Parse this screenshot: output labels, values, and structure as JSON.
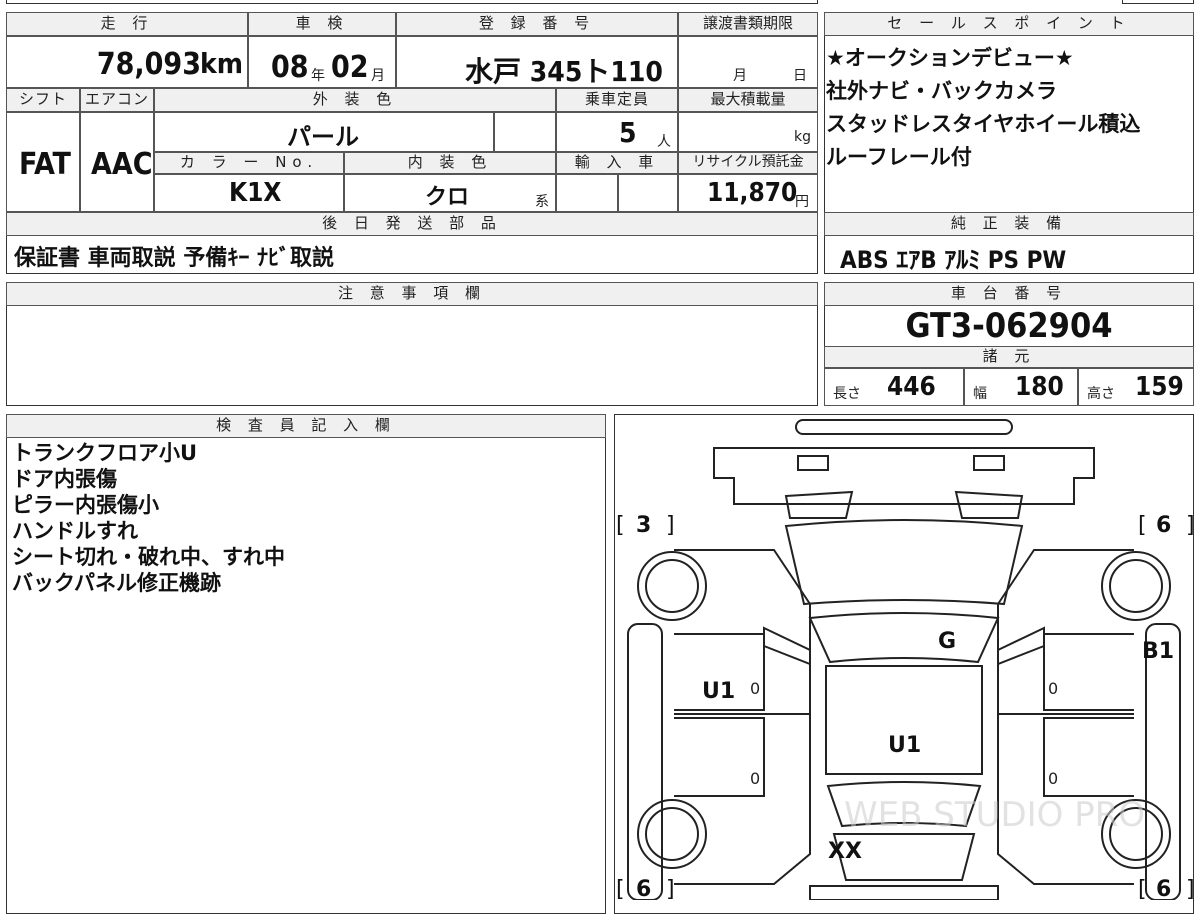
{
  "mileage": {
    "label": "走 行",
    "value": "78,093",
    "unit": "km"
  },
  "inspection": {
    "label": "車 検",
    "year": "08",
    "year_unit": "年",
    "month": "02",
    "month_unit": "月"
  },
  "registration": {
    "label": "登 録 番 号",
    "value": "水戸 345ト110"
  },
  "transfer_deadline": {
    "label": "譲渡書類期限",
    "month_unit": "月",
    "day_unit": "日"
  },
  "shift": {
    "label": "シフト",
    "value": "FAT"
  },
  "aircon": {
    "label": "エアコン",
    "value": "AAC"
  },
  "exterior_color": {
    "label": "外 装 色",
    "value": "パール"
  },
  "capacity": {
    "label": "乗車定員",
    "value": "5",
    "unit": "人"
  },
  "max_load": {
    "label": "最大積載量",
    "unit": "kg"
  },
  "color_no": {
    "label": "カ ラ ー No.",
    "value": "K1X"
  },
  "interior_color": {
    "label": "内 装 色",
    "value": "クロ",
    "suffix": "系"
  },
  "import": {
    "label": "輸 入 車"
  },
  "recycle": {
    "label": "リサイクル預託金",
    "value": "11,870",
    "unit": "円"
  },
  "later_parts": {
    "label": "後 日 発 送 部 品",
    "value": "保証書 車両取説 予備ｷｰ ﾅﾋﾞ取説"
  },
  "sales_points": {
    "label": "セ ー ル ス ポ イ ン ト",
    "lines": [
      "★オークションデビュー★",
      "社外ナビ・バックカメラ",
      "スタッドレスタイヤホイール積込",
      "ルーフレール付"
    ]
  },
  "equipment": {
    "label": "純 正 装 備",
    "value": "ABS ｴｱB ｱﾙﾐ PS PW"
  },
  "notes": {
    "label": "注 意 事 項 欄"
  },
  "chassis": {
    "label": "車 台 番 号",
    "value": "GT3-062904"
  },
  "specs": {
    "label": "諸 元",
    "length_label": "長さ",
    "length": "446",
    "width_label": "幅",
    "width": "180",
    "height_label": "高さ",
    "height": "159"
  },
  "inspector": {
    "label": "検 査 員 記 入 欄",
    "lines": [
      "トランクフロア小U",
      "ドア内張傷",
      "ピラー内張傷小",
      "ハンドルすれ",
      "シート切れ・破れ中、すれ中",
      "バックパネル修正機跡"
    ]
  },
  "diagram": {
    "tire_fl": "3",
    "tire_fr": "6",
    "tire_rl": "6",
    "tire_rr": "6",
    "mark_u1_left": "U1",
    "mark_g": "G",
    "mark_b1": "B1",
    "mark_u1_center": "U1",
    "mark_xx": "XX",
    "zero": "0",
    "watermark": "WEB STUDIO PRO"
  }
}
